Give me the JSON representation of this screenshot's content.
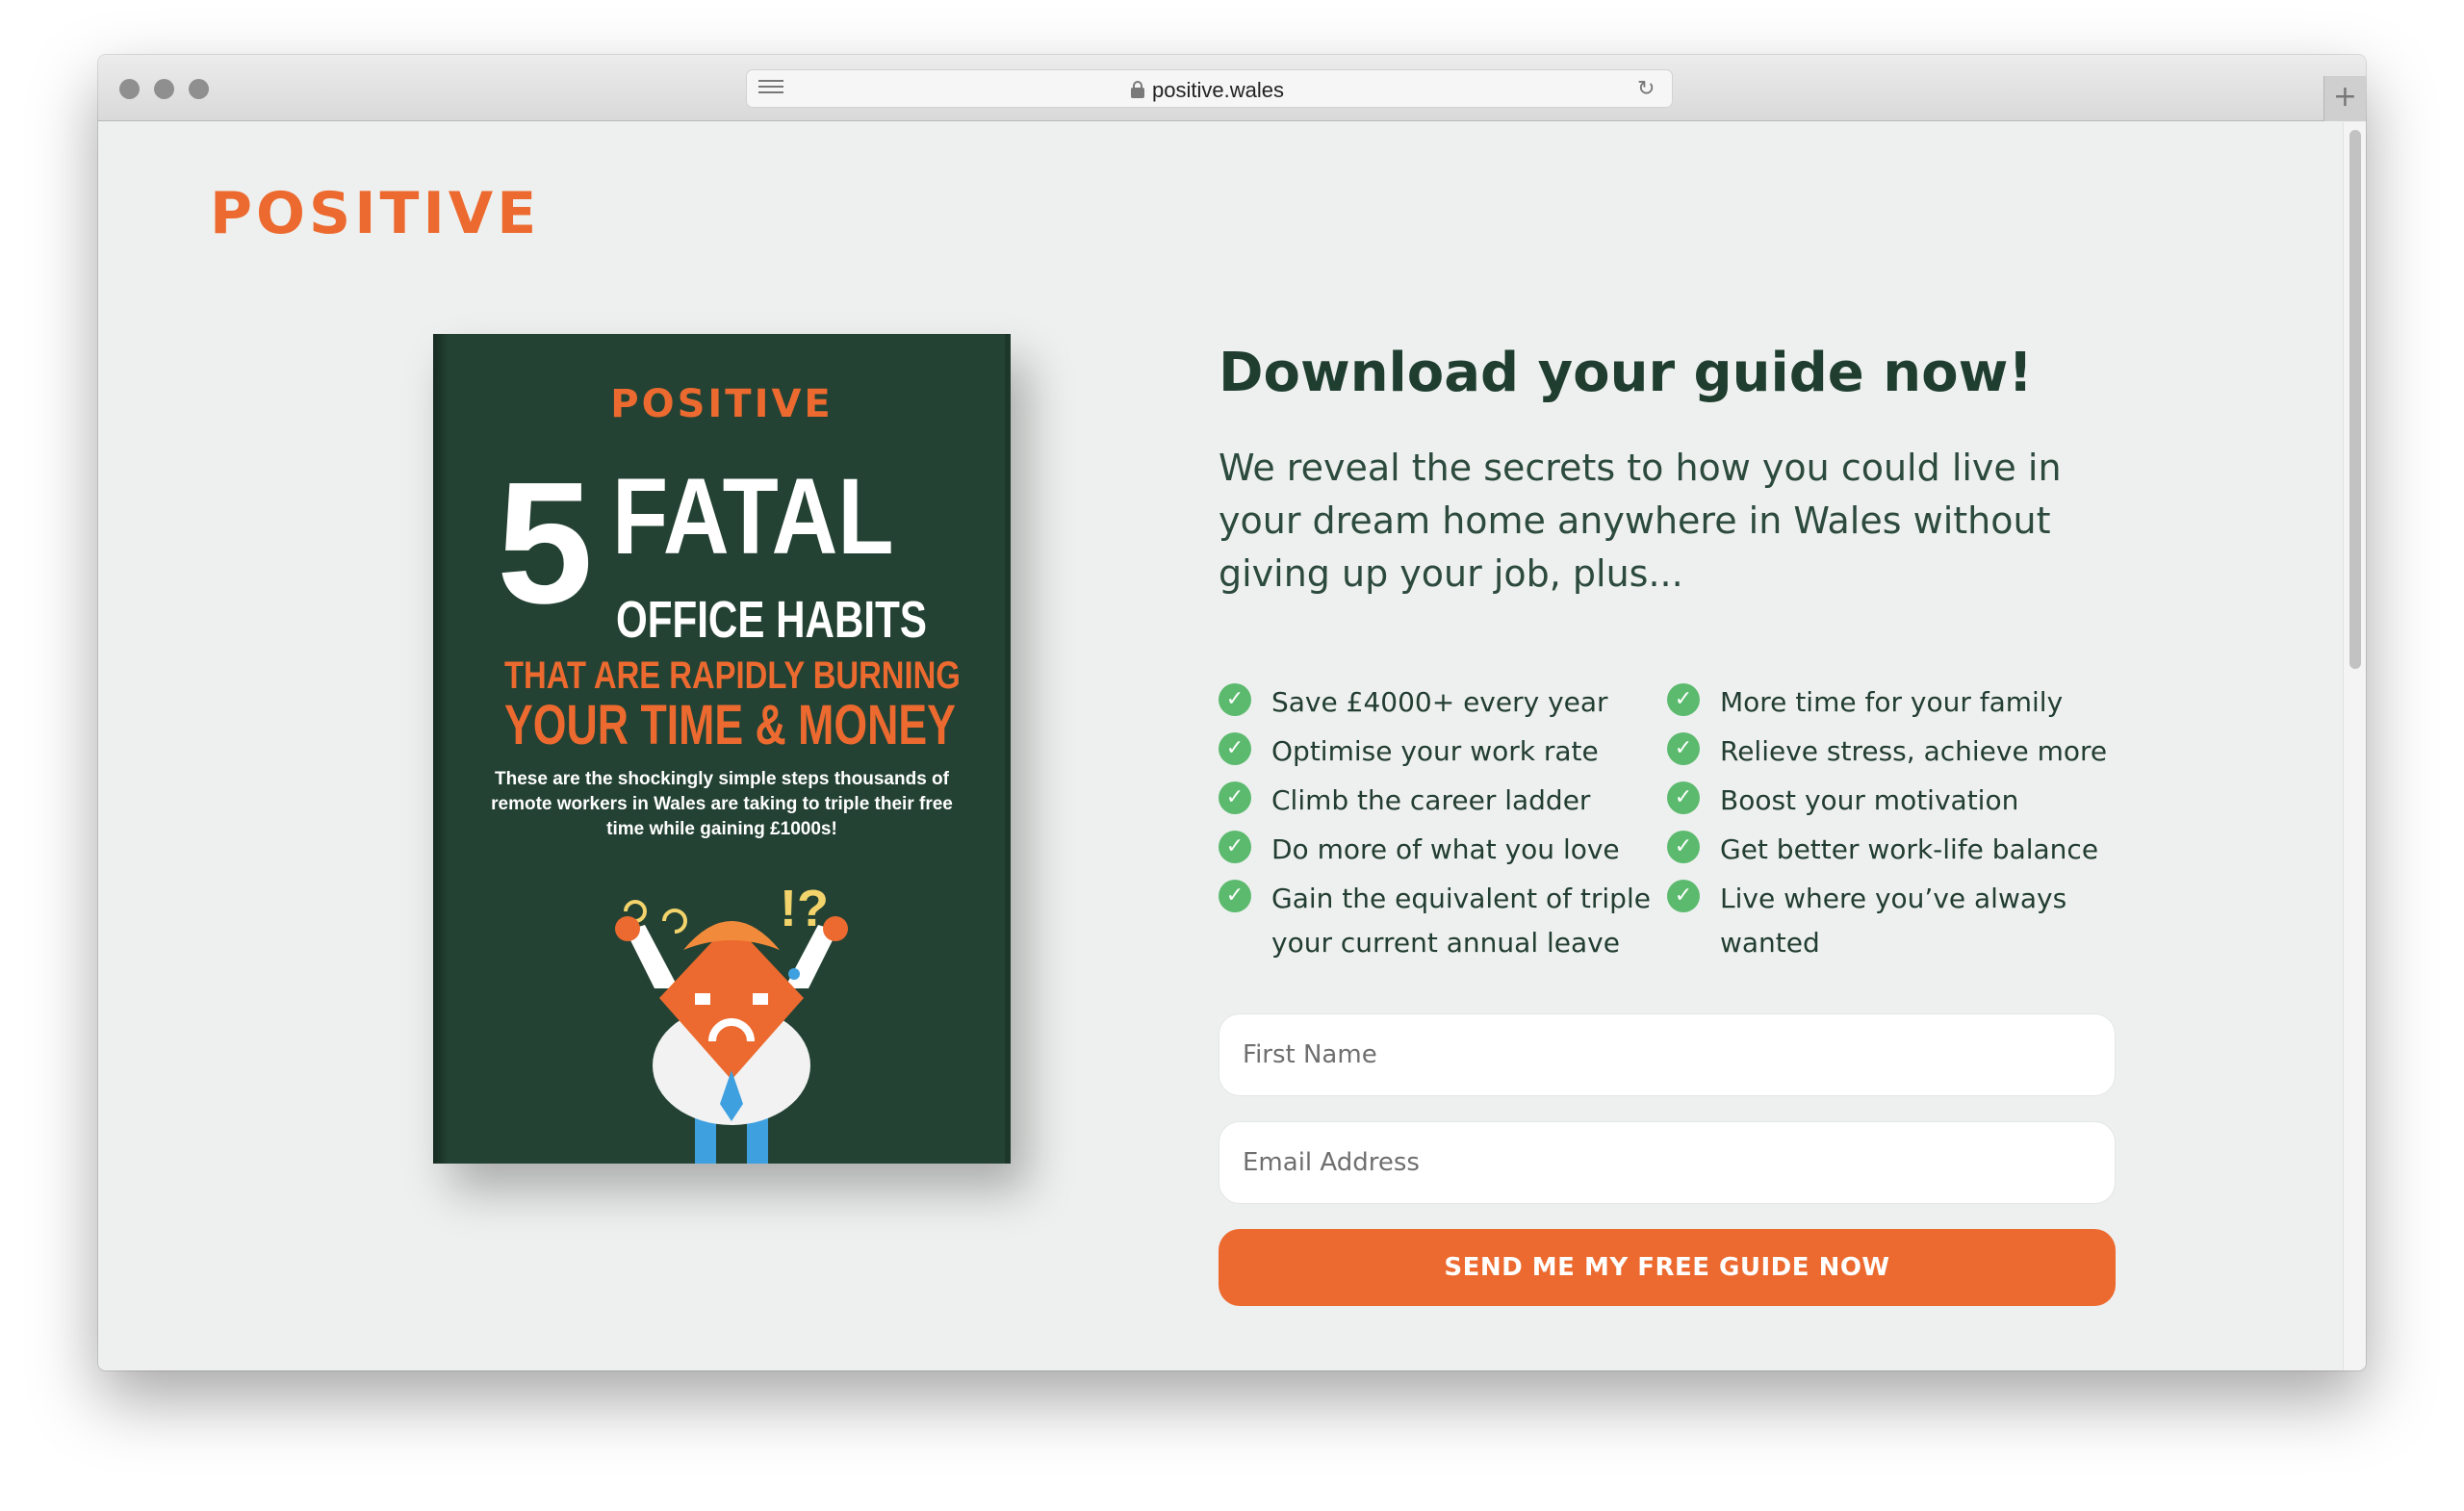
{
  "browser": {
    "url": "positive.wales"
  },
  "page": {
    "logo_text": "POSITIVE",
    "headline": "Download your guide now!",
    "intro": "We reveal the secrets to how you could live in your dream home anywhere in Wales without giving up your job, plus...",
    "benefits_left": [
      "Save £4000+ every year",
      "Optimise your work rate",
      "Climb the career ladder",
      "Do more of what you love",
      "Gain the equivalent of triple your current annual leave"
    ],
    "benefits_right": [
      "More time for your family",
      "Relieve stress, achieve more",
      "Boost your motivation",
      "Get better work-life balance",
      "Live where you’ve always wanted"
    ],
    "form": {
      "first_name_placeholder": "First Name",
      "email_placeholder": "Email Address",
      "submit_label": "SEND ME MY FREE GUIDE NOW"
    }
  },
  "book": {
    "logo_text": "POSITIVE",
    "number": "5",
    "title_line1": "FATAL",
    "title_line2": "OFFICE HABITS",
    "subtitle_line1": "THAT ARE RAPIDLY BURNING",
    "subtitle_line2": "YOUR TIME & MONEY",
    "blurb": "These are the shockingly simple steps thousands of remote workers in Wales are taking to triple their free time while gaining £1000s!",
    "exclaim": "!?"
  },
  "colors": {
    "brand_orange": "#ec6a2f",
    "dark_green": "#234233",
    "check_green": "#5cba6e",
    "page_bg": "#eef0ef"
  },
  "icons": {
    "check": "check-circle-icon",
    "lock": "lock-icon",
    "reload": "reload-icon",
    "reader": "reader-icon",
    "new_tab": "plus-icon"
  }
}
